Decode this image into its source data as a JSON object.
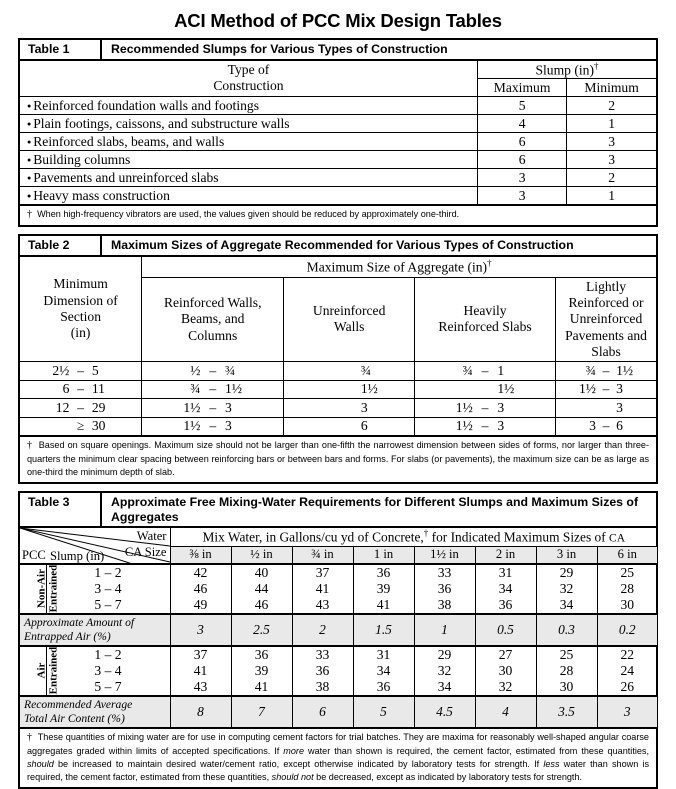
{
  "document": {
    "title": "ACI Method of PCC Mix Design Tables"
  },
  "table1": {
    "label": "Table 1",
    "caption": "Recommended Slumps for Various Types of Construction",
    "header": {
      "type_of_construction_line1": "Type of",
      "type_of_construction_line2": "Construction",
      "slump_group": "Slump (in)",
      "slump_group_dagger": "†",
      "maximum": "Maximum",
      "minimum": "Minimum"
    },
    "rows": [
      {
        "construction": "Reinforced foundation walls and footings",
        "maximum": "5",
        "minimum": "2"
      },
      {
        "construction": "Plain footings, caissons, and substructure walls",
        "maximum": "4",
        "minimum": "1"
      },
      {
        "construction": "Reinforced slabs, beams, and walls",
        "maximum": "6",
        "minimum": "3"
      },
      {
        "construction": "Building columns",
        "maximum": "6",
        "minimum": "3"
      },
      {
        "construction": "Pavements and unreinforced slabs",
        "maximum": "3",
        "minimum": "2"
      },
      {
        "construction": "Heavy mass construction",
        "maximum": "3",
        "minimum": "1"
      }
    ],
    "footnote": "When high-frequency vibrators are used, the values given should be reduced by approximately one-third."
  },
  "table2": {
    "label": "Table 2",
    "caption": "Maximum Sizes of Aggregate Recommended for Various Types of Construction",
    "header": {
      "min_dimension_line1": "Minimum",
      "min_dimension_line2": "Dimension of",
      "min_dimension_line3": "Section",
      "min_dimension_line4": "(in)",
      "group_title": "Maximum Size of Aggregate (in)",
      "group_dagger": "†",
      "col_reinforced_walls": "Reinforced Walls,\nBeams, and\nColumns",
      "col_unreinforced_walls": "Unreinforced\nWalls",
      "col_heavily_reinforced": "Heavily\nReinforced Slabs",
      "col_lightly_reinforced": "Lightly Reinforced or\nUnreinforced\nPavements and Slabs"
    },
    "rows": [
      {
        "dimension": {
          "a": "2½",
          "dash": "–",
          "b": "5"
        },
        "reinforced_walls": {
          "a": "½",
          "dash": "–",
          "b": "¾"
        },
        "unreinforced_walls": {
          "a": "",
          "dash": "",
          "b": "¾"
        },
        "heavily_reinforced": {
          "a": "¾",
          "dash": "–",
          "b": "1"
        },
        "lightly_reinforced": {
          "a": "¾",
          "dash": "–",
          "b": "1½"
        }
      },
      {
        "dimension": {
          "a": "6",
          "dash": "–",
          "b": "11"
        },
        "reinforced_walls": {
          "a": "¾",
          "dash": "–",
          "b": "1½"
        },
        "unreinforced_walls": {
          "a": "",
          "dash": "",
          "b": "1½"
        },
        "heavily_reinforced": {
          "a": "",
          "dash": "",
          "b": "1½"
        },
        "lightly_reinforced": {
          "a": "1½",
          "dash": "–",
          "b": "3"
        }
      },
      {
        "dimension": {
          "a": "12",
          "dash": "–",
          "b": "29"
        },
        "reinforced_walls": {
          "a": "1½",
          "dash": "–",
          "b": "3"
        },
        "unreinforced_walls": {
          "a": "",
          "dash": "",
          "b": "3"
        },
        "heavily_reinforced": {
          "a": "1½",
          "dash": "–",
          "b": "3"
        },
        "lightly_reinforced": {
          "a": "",
          "dash": "",
          "b": "3"
        }
      },
      {
        "dimension": {
          "a": "",
          "dash": "≥",
          "b": "30"
        },
        "reinforced_walls": {
          "a": "1½",
          "dash": "–",
          "b": "3"
        },
        "unreinforced_walls": {
          "a": "",
          "dash": "",
          "b": "6"
        },
        "heavily_reinforced": {
          "a": "1½",
          "dash": "–",
          "b": "3"
        },
        "lightly_reinforced": {
          "a": "3",
          "dash": "–",
          "b": "6"
        }
      }
    ],
    "footnote": "Based on square openings. Maximum size should not be larger than one-fifth the narrowest dimension between sides of forms, nor larger than three-quarters the minimum clear spacing between reinforcing bars or between bars and forms. For slabs (or pavements), the maximum size can be as large as one-third the minimum depth of slab."
  },
  "table3": {
    "label": "Table 3",
    "caption": "Approximate Free Mixing-Water Requirements for Different Slumps and Maximum Sizes of Aggregates",
    "corner": {
      "water": "Water",
      "ca_size": "CA Size",
      "pcc": "PCC",
      "slump": "Slump (in)"
    },
    "banner": {
      "text_before": "Mix Water, in Gallons/cu yd of Concrete,",
      "dagger": "†",
      "text_after": "for Indicated Maximum Sizes of",
      "ca": "CA"
    },
    "size_columns": [
      "⅜ in",
      "½ in",
      "¾ in",
      "1 in",
      "1½ in",
      "2 in",
      "3 in",
      "6 in"
    ],
    "non_air_entrained": {
      "group_label_line1": "Non-Air",
      "group_label_line2": "Entrained",
      "rows": [
        {
          "slump": "1 – 2",
          "values": [
            "42",
            "40",
            "37",
            "36",
            "33",
            "31",
            "29",
            "25"
          ]
        },
        {
          "slump": "3 – 4",
          "values": [
            "46",
            "44",
            "41",
            "39",
            "36",
            "34",
            "32",
            "28"
          ]
        },
        {
          "slump": "5 – 7",
          "values": [
            "49",
            "46",
            "43",
            "41",
            "38",
            "36",
            "34",
            "30"
          ]
        }
      ]
    },
    "entrapped_air": {
      "label_line1": "Approximate Amount of",
      "label_line2": "Entrapped Air (%)",
      "values": [
        "3",
        "2.5",
        "2",
        "1.5",
        "1",
        "0.5",
        "0.3",
        "0.2"
      ]
    },
    "air_entrained": {
      "group_label_line1": "Air",
      "group_label_line2": "Entrained",
      "rows": [
        {
          "slump": "1 – 2",
          "values": [
            "37",
            "36",
            "33",
            "31",
            "29",
            "27",
            "25",
            "22"
          ]
        },
        {
          "slump": "3 – 4",
          "values": [
            "41",
            "39",
            "36",
            "34",
            "32",
            "30",
            "28",
            "24"
          ]
        },
        {
          "slump": "5 – 7",
          "values": [
            "43",
            "41",
            "38",
            "36",
            "34",
            "32",
            "30",
            "26"
          ]
        }
      ]
    },
    "total_air": {
      "label_line1": "Recommended Average",
      "label_line2": "Total Air Content (%)",
      "values": [
        "8",
        "7",
        "6",
        "5",
        "4.5",
        "4",
        "3.5",
        "3"
      ]
    },
    "footnote_parts": {
      "p1": "These quantities of mixing water are for use in computing cement factors for trial batches. They are maxima for reasonably well-shaped angular coarse aggregates graded within limits of accepted specifications. If ",
      "em1": "more",
      "p2": " water than shown is required, the cement factor, estimated from these quantities, ",
      "em2": "should",
      "p3": " be increased to maintain desired water/cement ratio, except otherwise indicated by laboratory tests for strength. If ",
      "em3": "less",
      "p4": " water than shown is required, the cement factor, estimated from these quantities, ",
      "em4": "should not",
      "p5": " be decreased, except as indicated by laboratory tests for strength."
    }
  }
}
